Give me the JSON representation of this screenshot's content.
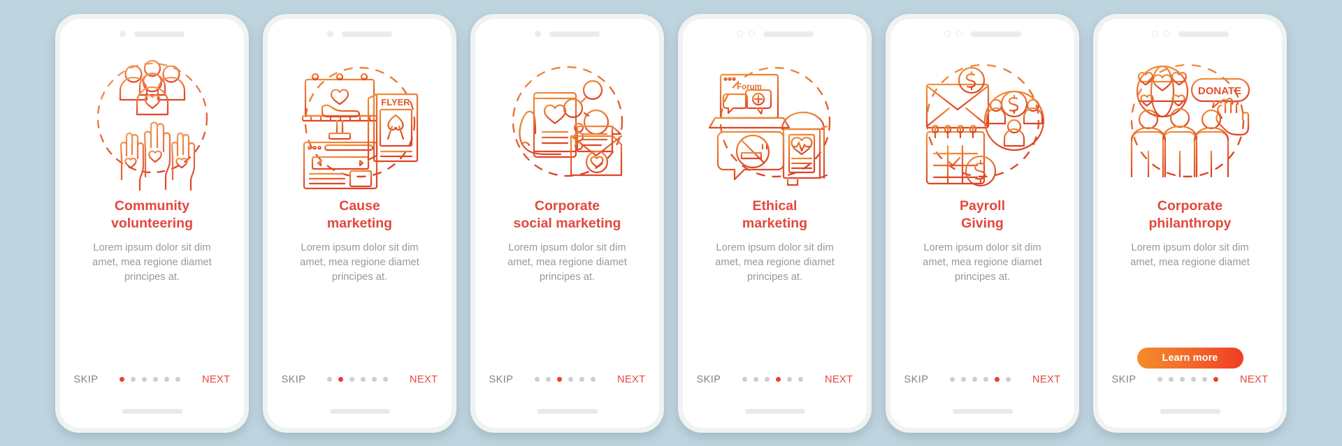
{
  "background_color": "#bed4de",
  "theme": {
    "title_color": "#e2483c",
    "desc_color": "#97999b",
    "skip_color": "#808285",
    "next_color": "#e2483c",
    "dot_active_color": "#ed3f2b",
    "dot_inactive_color": "#cdced0",
    "button_gradient_from": "#f58b2c",
    "button_gradient_to": "#ee3d25"
  },
  "nav": {
    "skip_label": "SKIP",
    "next_label": "NEXT",
    "total_dots": 6
  },
  "screens": [
    {
      "title": "Community\nvolunteering",
      "description": "Lorem ipsum dolor sit dim\namet, mea regione diamet\nprincipes at.",
      "active_dot": 0,
      "illustration": "community-volunteering-illustration",
      "illustration_parts": [
        "people-group-heart",
        "raised-hands-hearts",
        "dashed-circle"
      ],
      "has_learn_more": false
    },
    {
      "title": "Cause\nmarketing",
      "description": "Lorem ipsum dolor sit dim\namet, mea regione diamet\nprincipes at.",
      "active_dot": 1,
      "illustration": "cause-marketing-illustration",
      "illustration_parts": [
        "billboard-heart-hand",
        "flyer-ribbon",
        "web-banner",
        "dashed-circle"
      ],
      "illustration_text": "FLYER",
      "has_learn_more": false
    },
    {
      "title": "Corporate\nsocial marketing",
      "description": "Lorem ipsum dolor sit dim\namet, mea regione diamet\nprincipes at.",
      "active_dot": 2,
      "illustration": "corporate-social-marketing-illustration",
      "illustration_parts": [
        "hand-holding-phone-heart",
        "share-nodes",
        "open-envelope-heart",
        "dashed-circle"
      ],
      "has_learn_more": false
    },
    {
      "title": "Ethical\nmarketing",
      "description": "Lorem ipsum dolor sit dim\namet, mea regione diamet\nprincipes at.",
      "active_dot": 3,
      "illustration": "ethical-marketing-illustration",
      "illustration_parts": [
        "laptop-forum-chat",
        "no-smoking-speech-bubble",
        "bus-stop-health-poster",
        "dashed-circle"
      ],
      "illustration_text": "Forum",
      "has_learn_more": false
    },
    {
      "title": "Payroll\nGiving",
      "description": "Lorem ipsum dolor sit dim\namet, mea regione diamet\nprincipes at.",
      "active_dot": 4,
      "illustration": "payroll-giving-illustration",
      "illustration_parts": [
        "envelope-dollar",
        "calendar-dollar",
        "people-dollar-circle",
        "dashed-circle"
      ],
      "illustration_text": "$",
      "has_learn_more": false
    },
    {
      "title": "Corporate\nphilanthropy",
      "description": "Lorem ipsum dolor sit dim\namet, mea regione diamet",
      "active_dot": 5,
      "illustration": "corporate-philanthropy-illustration",
      "illustration_parts": [
        "globe-hearts",
        "donate-speech-bubble-cursor",
        "three-people",
        "dashed-circle"
      ],
      "illustration_text": "DONATE",
      "has_learn_more": true,
      "learn_more_label": "Learn more"
    }
  ]
}
